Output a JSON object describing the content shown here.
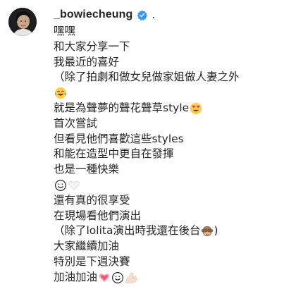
{
  "post": {
    "username": "_bowiecheung",
    "separator": "."
  },
  "caption": {
    "lines": [
      "嘿嘿",
      "和大家分享一下",
      "我最近的喜好",
      "（除了拍劇和做女兒做家姐做人妻之外",
      "",
      "就是為聲夢的聲花聲草style",
      "首次嘗試",
      "但看見他們喜歡這些styles",
      "和能在造型中更自在發揮",
      "也是一種快樂",
      "",
      "還有真的很享受",
      "在現場看他們演出",
      "（除了lolita演出時我還在後台",
      "大家繼續加油",
      "特別是下週決賽",
      "加油加油"
    ]
  },
  "icons": {
    "verified": "verified-badge-icon",
    "tears_of_joy": "face-with-tears-of-joy-emoji",
    "heart_eyes": "smiling-face-with-heart-eyes-emoji",
    "smile": "smiling-face-emoji",
    "white_heart": "white-heart-emoji",
    "see_no_evil": "see-no-evil-monkey-emoji",
    "growing_heart": "growing-heart-emoji",
    "flexed_biceps": "flexed-biceps-emoji"
  },
  "colors": {
    "verified_blue": "#3897f0",
    "text": "#262626"
  }
}
